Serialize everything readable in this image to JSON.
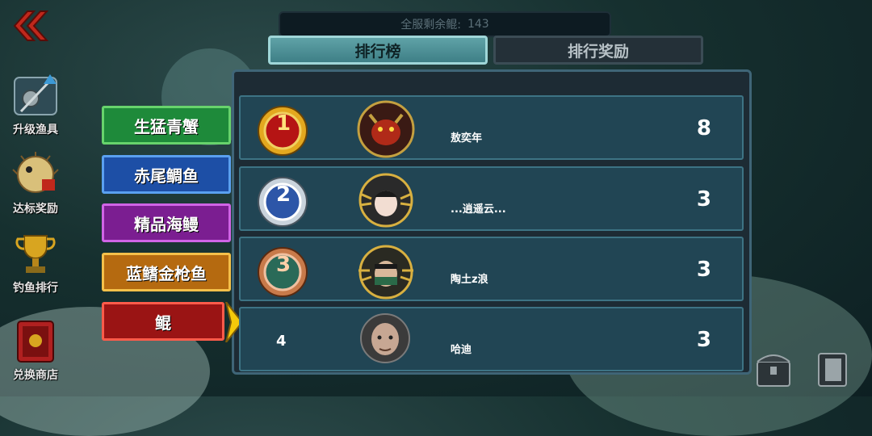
{
  "top_counter": {
    "label": "全服剩余鲲:",
    "value": "143"
  },
  "tabs": {
    "ranking": "排行榜",
    "rewards": "排行奖励"
  },
  "side_nav": [
    {
      "label": "升级渔具",
      "icon": "fishing-rod-icon"
    },
    {
      "label": "达标奖励",
      "icon": "pufferfish-icon"
    },
    {
      "label": "钓鱼排行",
      "icon": "trophy-icon"
    },
    {
      "label": "兑换商店",
      "icon": "shop-book-icon"
    }
  ],
  "fish_categories": [
    {
      "label": "生猛青蟹",
      "color": "#1e8a3a",
      "border": "#67d36c"
    },
    {
      "label": "赤尾鲷鱼",
      "color": "#1d4fa6",
      "border": "#5aa0f0"
    },
    {
      "label": "精品海鳗",
      "color": "#7b1e91",
      "border": "#d064e6"
    },
    {
      "label": "蓝鳍金枪鱼",
      "color": "#b56a10",
      "border": "#f4c04a"
    },
    {
      "label": "鲲",
      "color": "#9a1414",
      "border": "#ff5b4a",
      "selected": true
    }
  ],
  "leaderboard": [
    {
      "rank": "1",
      "name": "敖奕年",
      "score": "8",
      "medal": "gold"
    },
    {
      "rank": "2",
      "name": "...逍遥云...",
      "score": "3",
      "medal": "silver"
    },
    {
      "rank": "3",
      "name": "陶土z浪",
      "score": "3",
      "medal": "bronze"
    },
    {
      "rank": "4",
      "name": "哈迪",
      "score": "3",
      "medal": "none"
    }
  ],
  "colors": {
    "accent": "#5fa2a7",
    "row_bg": "#214554",
    "panel_border": "#3f6577"
  }
}
